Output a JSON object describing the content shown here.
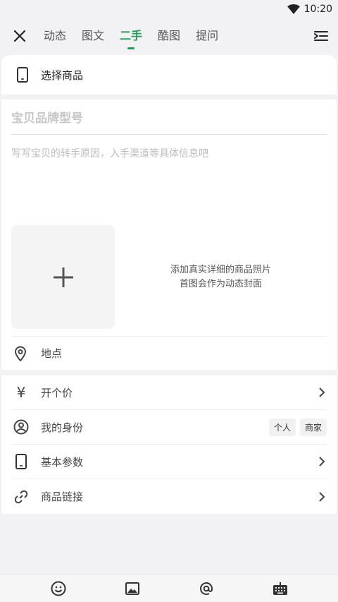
{
  "status_bar": {
    "time": "10:20"
  },
  "tabs": [
    {
      "label": "动态"
    },
    {
      "label": "图文"
    },
    {
      "label": "二手"
    },
    {
      "label": "酷图"
    },
    {
      "label": "提问"
    }
  ],
  "select_product": {
    "label": "选择商品"
  },
  "form": {
    "title_placeholder": "宝贝品牌型号",
    "desc_placeholder": "写写宝贝的转手原因，入手渠道等具体信息吧",
    "photo_hint_line1": "添加真实详细的商品照片",
    "photo_hint_line2": "首图会作为动态封面",
    "location_label": "地点"
  },
  "options": {
    "price_label": "开个价",
    "identity_label": "我的身份",
    "identity_personal": "个人",
    "identity_merchant": "商家",
    "params_label": "基本参数",
    "link_label": "商品链接"
  },
  "colors": {
    "accent": "#20a05a",
    "background": "#f2f1f4"
  }
}
